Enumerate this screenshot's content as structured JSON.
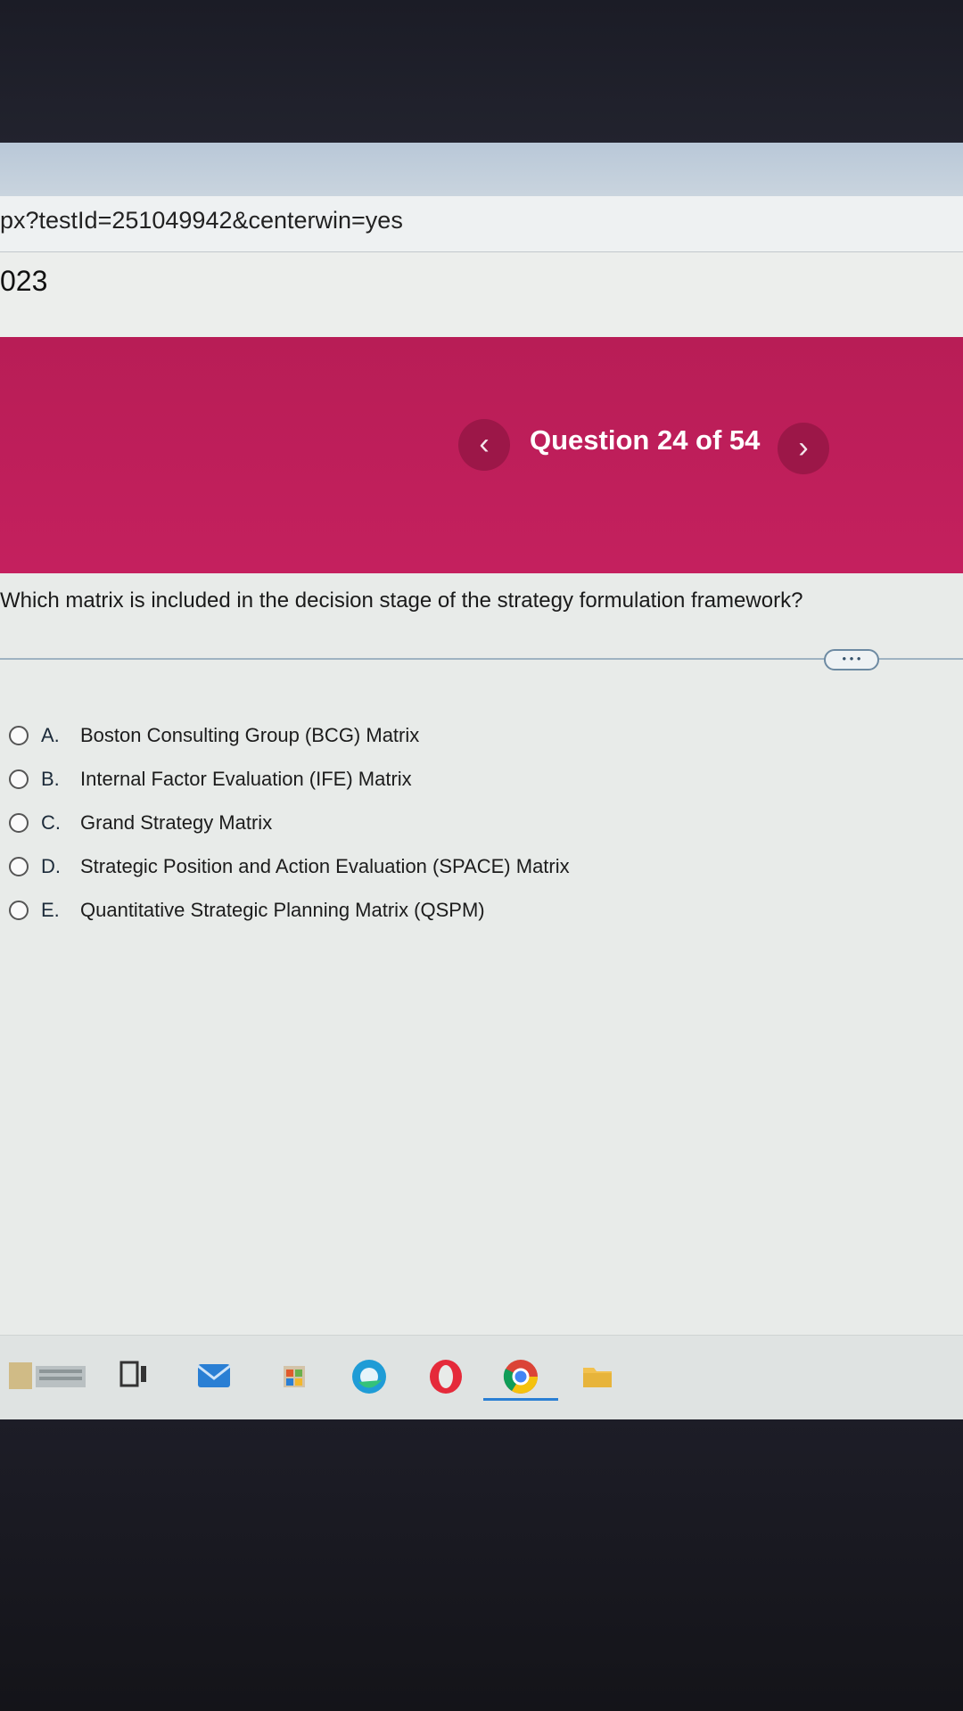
{
  "browser": {
    "url": "px?testId=251049942&centerwin=yes"
  },
  "page": {
    "title_fragment": "023"
  },
  "banner": {
    "prev_label": "‹",
    "question_counter": "Question 24 of 54",
    "next_label": "›",
    "accent_color": "#c4205e"
  },
  "question": {
    "text": "Which matrix is included in the decision stage of the strategy formulation framework?",
    "more_label": "• • •"
  },
  "options": [
    {
      "letter": "A.",
      "text": "Boston Consulting Group (BCG) Matrix"
    },
    {
      "letter": "B.",
      "text": "Internal Factor Evaluation (IFE) Matrix"
    },
    {
      "letter": "C.",
      "text": "Grand Strategy Matrix"
    },
    {
      "letter": "D.",
      "text": "Strategic Position and Action Evaluation (SPACE) Matrix"
    },
    {
      "letter": "E.",
      "text": "Quantitative Strategic Planning Matrix (QSPM)"
    }
  ],
  "taskbar": {
    "icons": [
      "widgets-icon",
      "task-view-icon",
      "mail-icon",
      "store-icon",
      "edge-icon",
      "opera-icon",
      "chrome-icon",
      "file-explorer-icon"
    ]
  }
}
